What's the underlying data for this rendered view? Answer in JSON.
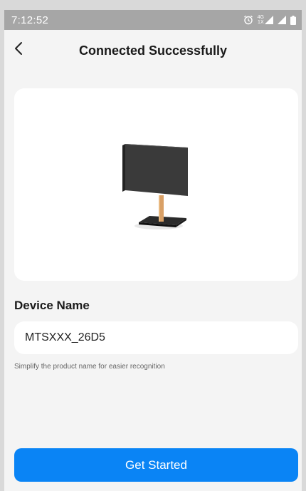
{
  "status_bar": {
    "time": "7:12:52",
    "network_label_top": "4G",
    "network_label_bottom": "1X",
    "icons": [
      "alarm-icon",
      "signal-4g-icon",
      "signal-icon",
      "battery-icon"
    ]
  },
  "header": {
    "title": "Connected Successfully",
    "back_icon": "chevron-left-icon"
  },
  "device_card": {
    "image": "tv-stand-illustration"
  },
  "device_name_section": {
    "label": "Device Name",
    "input_value": "MTSXXX_26D5",
    "hint": "Simplify the product name for easier recognition"
  },
  "actions": {
    "primary_label": "Get Started"
  },
  "colors": {
    "primary": "#0a84f5",
    "background": "#f4f4f4",
    "card": "#ffffff",
    "status_bar": "#a6a6a6"
  }
}
